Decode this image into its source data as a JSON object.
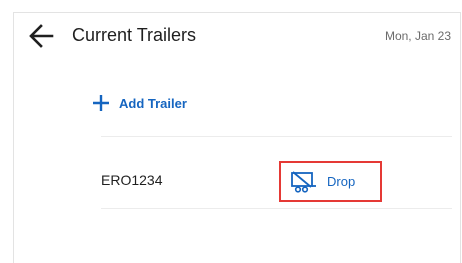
{
  "header": {
    "title": "Current Trailers",
    "date": "Mon, Jan 23"
  },
  "actions": {
    "add_trailer_label": "Add Trailer"
  },
  "trailers": [
    {
      "id": "ERO1234",
      "action_label": "Drop"
    }
  ],
  "colors": {
    "accent": "#1565c0",
    "highlight": "#e53935",
    "text": "#1f1f1f",
    "muted": "#6b6b6b"
  },
  "icons": {
    "back": "arrow-left-icon",
    "add": "plus-icon",
    "drop": "trailer-drop-icon"
  }
}
